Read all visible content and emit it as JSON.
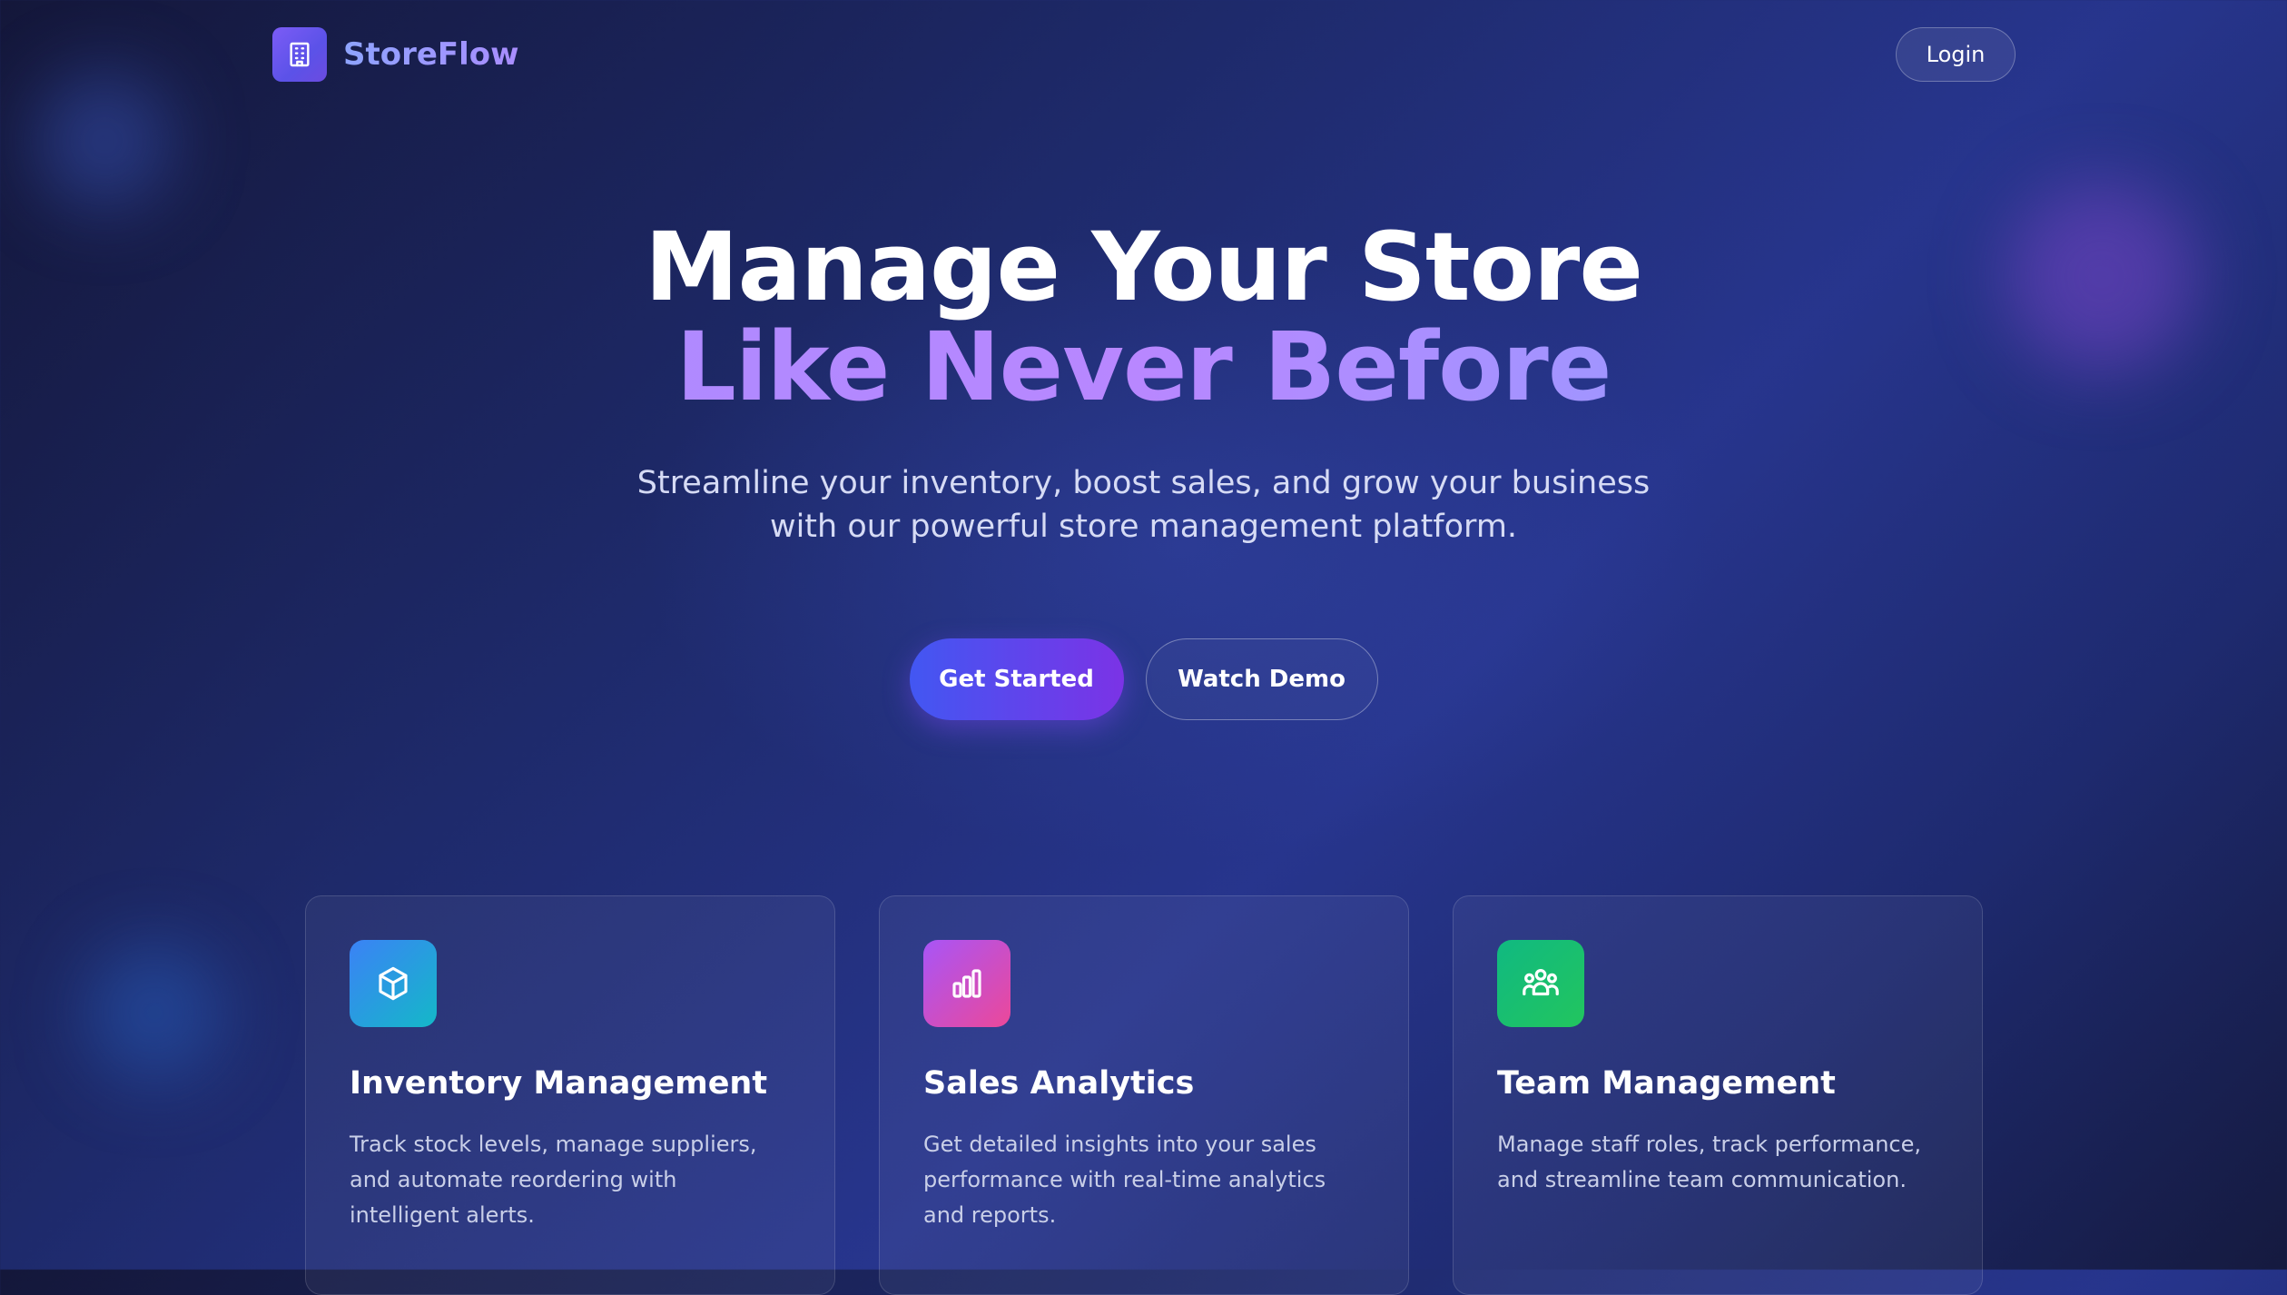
{
  "header": {
    "brand_name": "StoreFlow",
    "brand_icon": "building-icon",
    "login_label": "Login"
  },
  "hero": {
    "title_line1": "Manage Your Store",
    "title_line2": "Like Never Before",
    "subtitle": "Streamline your inventory, boost sales, and grow your business with our powerful store management platform.",
    "primary_cta": "Get Started",
    "secondary_cta": "Watch Demo"
  },
  "features": [
    {
      "icon": "cube-icon",
      "title": "Inventory Management",
      "description": "Track stock levels, manage suppliers, and automate reordering with intelligent alerts."
    },
    {
      "icon": "bar-chart-icon",
      "title": "Sales Analytics",
      "description": "Get detailed insights into your sales performance with real-time analytics and reports."
    },
    {
      "icon": "users-icon",
      "title": "Team Management",
      "description": "Manage staff roles, track performance, and streamline team communication."
    }
  ],
  "colors": {
    "accent_start": "#4257f2",
    "accent_end": "#7b33e6",
    "brand_gradient_start": "#8ea4ff",
    "brand_gradient_end": "#a98dff"
  }
}
